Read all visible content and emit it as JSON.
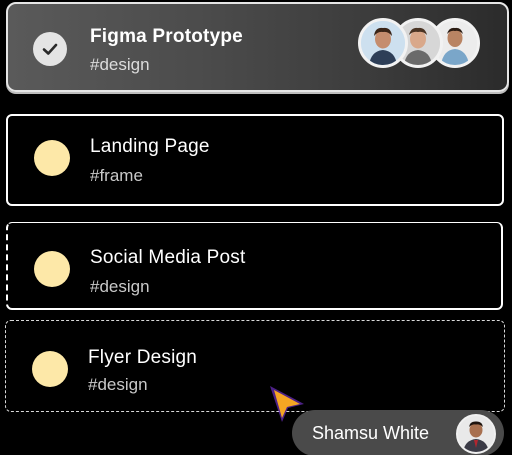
{
  "active_card": {
    "title": "Figma Prototype",
    "tag": "#design",
    "status": "checked",
    "avatars": [
      "avatar",
      "avatar",
      "avatar"
    ]
  },
  "tasks": [
    {
      "title": "Landing Page",
      "tag": "#frame"
    },
    {
      "title": "Social Media Post",
      "tag": "#design"
    },
    {
      "title": "Flyer Design",
      "tag": "#design"
    }
  ],
  "cursor": {
    "user_name": "Shamsu White",
    "color": "#8b3cf6",
    "accent": "#f5a623"
  },
  "colors": {
    "dot": "#fde8a8",
    "background": "#000000"
  }
}
